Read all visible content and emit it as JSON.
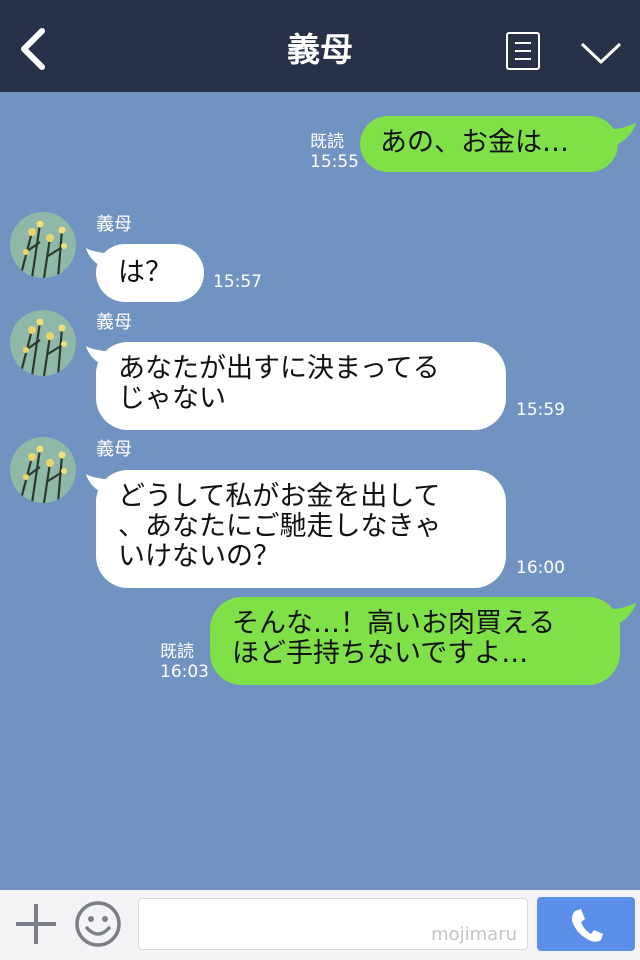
{
  "header": {
    "title": "義母",
    "back_icon": "back-arrow-icon",
    "menu_icon": "menu-list-icon",
    "collapse_icon": "chevron-down-icon",
    "background": "#273248"
  },
  "chat": {
    "background": "#7193c2",
    "sent_bubble_color": "#7fe048",
    "received_bubble_color": "#ffffff",
    "messages": [
      {
        "from": "me",
        "lines": [
          "あの、お金は…"
        ],
        "read_label": "既読",
        "time": "15:55"
      },
      {
        "from": "other",
        "sender": "義母",
        "lines": [
          "は？"
        ],
        "time": "15:57"
      },
      {
        "from": "other",
        "sender": "義母",
        "lines": [
          "あなたが出すに決まってる",
          "じゃない"
        ],
        "time": "15:59"
      },
      {
        "from": "other",
        "sender": "義母",
        "lines": [
          "どうして私がお金を出して",
          "、あなたにご馳走しなきゃ",
          "いけないの？"
        ],
        "time": "16:00"
      },
      {
        "from": "me",
        "lines": [
          "そんな…！高いお肉買える",
          "ほど手持ちないですよ…"
        ],
        "read_label": "既読",
        "time": "16:03"
      }
    ]
  },
  "footer": {
    "plus_icon": "plus-icon",
    "emoji_icon": "emoji-icon",
    "input_value": "",
    "watermark": "mojimaru",
    "call_icon": "phone-icon",
    "send_color": "#5b8ee8"
  }
}
